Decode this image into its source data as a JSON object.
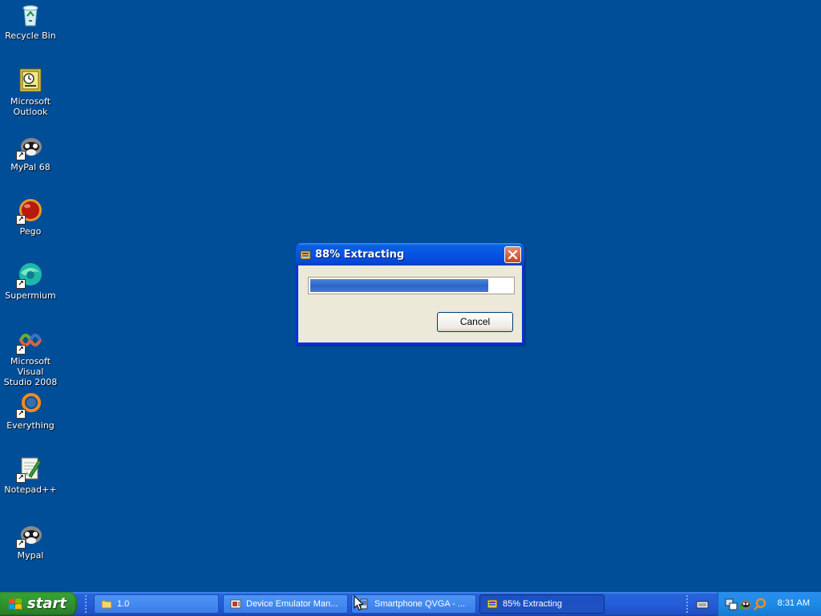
{
  "desktop": {
    "icons": [
      {
        "label": "Recycle Bin",
        "icon": "recycle-bin-icon"
      },
      {
        "label": "Microsoft\nOutlook",
        "icon": "outlook-icon"
      },
      {
        "label": "MyPal 68",
        "icon": "mypal-icon"
      },
      {
        "label": "Pego",
        "icon": "pego-icon"
      },
      {
        "label": "Supermium",
        "icon": "supermium-icon"
      },
      {
        "label": "Microsoft Visual\nStudio 2008",
        "icon": "visual-studio-icon"
      },
      {
        "label": "Everything",
        "icon": "everything-icon"
      },
      {
        "label": "Notepad++",
        "icon": "notepad-plus-plus-icon"
      },
      {
        "label": "Mypal",
        "icon": "mypal-icon"
      }
    ]
  },
  "dialog": {
    "title": "88% Extracting",
    "progress": 0.88,
    "cancel_label": "Cancel"
  },
  "taskbar": {
    "start_label": "start",
    "buttons": [
      {
        "label": "1.0",
        "icon": "folder-icon",
        "active": false
      },
      {
        "label": "Device Emulator Man...",
        "icon": "device-emulator-icon",
        "active": false
      },
      {
        "label": "Smartphone QVGA - ...",
        "icon": "smartphone-icon",
        "active": false
      },
      {
        "label": "85% Extracting",
        "icon": "archive-icon",
        "active": true
      }
    ],
    "clock": "8:31 AM"
  },
  "colors": {
    "desktop_bg": "#004E98",
    "taskbar_blue": "#245DDB",
    "start_green": "#2F922F",
    "dialog_face": "#ECE9D8",
    "progress_fill": "#2E66C8"
  }
}
